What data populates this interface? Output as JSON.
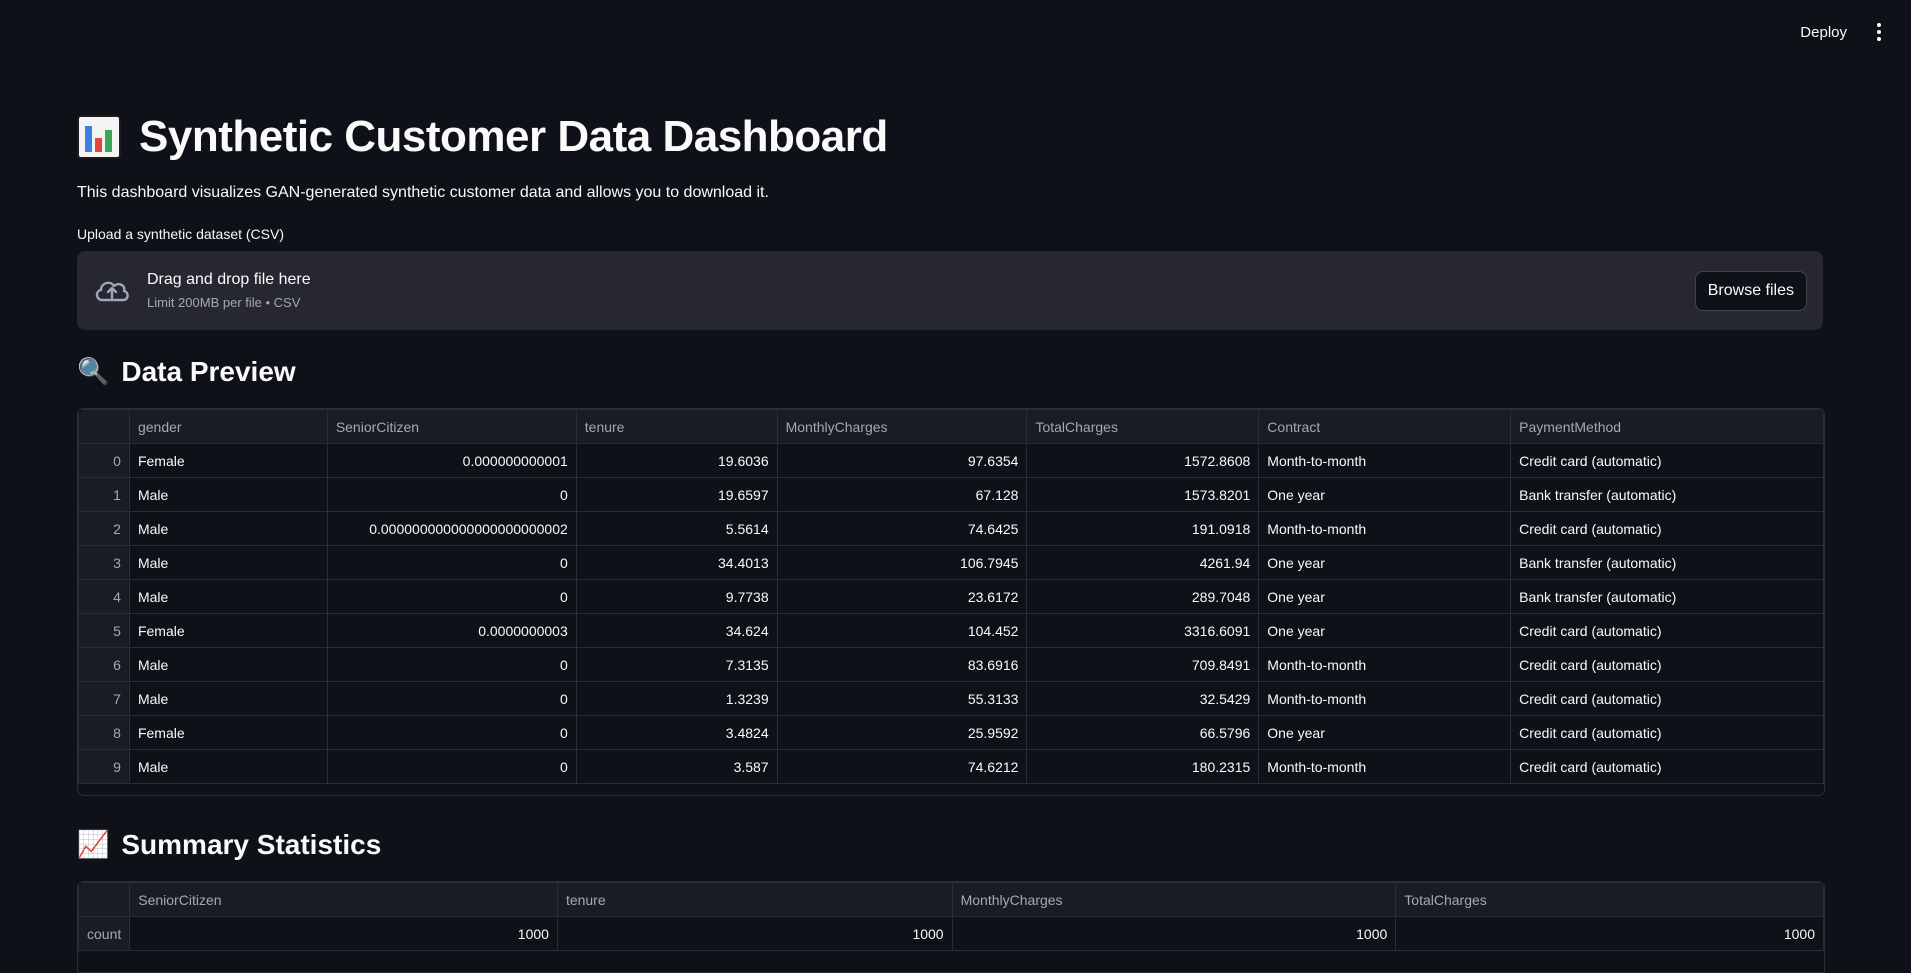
{
  "header": {
    "deploy_label": "Deploy"
  },
  "page": {
    "title_icon": "bar-chart-icon",
    "title": "Synthetic Customer Data Dashboard",
    "subtitle": "This dashboard visualizes GAN-generated synthetic customer data and allows you to download it."
  },
  "uploader": {
    "label": "Upload a synthetic dataset (CSV)",
    "drag_text": "Drag and drop file here",
    "limit_text": "Limit 200MB per file • CSV",
    "browse_label": "Browse files"
  },
  "preview": {
    "emoji": "🔍",
    "title": "Data Preview",
    "columns": [
      "gender",
      "SeniorCitizen",
      "tenure",
      "MonthlyCharges",
      "TotalCharges",
      "Contract",
      "PaymentMethod"
    ],
    "rows": [
      {
        "idx": "0",
        "cells": [
          "Female",
          "0.000000000001",
          "19.6036",
          "97.6354",
          "1572.8608",
          "Month-to-month",
          "Credit card (automatic)"
        ]
      },
      {
        "idx": "1",
        "cells": [
          "Male",
          "0",
          "19.6597",
          "67.128",
          "1573.8201",
          "One year",
          "Bank transfer (automatic)"
        ]
      },
      {
        "idx": "2",
        "cells": [
          "Male",
          "0.000000000000000000000002",
          "5.5614",
          "74.6425",
          "191.0918",
          "Month-to-month",
          "Credit card (automatic)"
        ]
      },
      {
        "idx": "3",
        "cells": [
          "Male",
          "0",
          "34.4013",
          "106.7945",
          "4261.94",
          "One year",
          "Bank transfer (automatic)"
        ]
      },
      {
        "idx": "4",
        "cells": [
          "Male",
          "0",
          "9.7738",
          "23.6172",
          "289.7048",
          "One year",
          "Bank transfer (automatic)"
        ]
      },
      {
        "idx": "5",
        "cells": [
          "Female",
          "0.0000000003",
          "34.624",
          "104.452",
          "3316.6091",
          "One year",
          "Credit card (automatic)"
        ]
      },
      {
        "idx": "6",
        "cells": [
          "Male",
          "0",
          "7.3135",
          "83.6916",
          "709.8491",
          "Month-to-month",
          "Credit card (automatic)"
        ]
      },
      {
        "idx": "7",
        "cells": [
          "Male",
          "0",
          "1.3239",
          "55.3133",
          "32.5429",
          "Month-to-month",
          "Credit card (automatic)"
        ]
      },
      {
        "idx": "8",
        "cells": [
          "Female",
          "0",
          "3.4824",
          "25.9592",
          "66.5796",
          "One year",
          "Credit card (automatic)"
        ]
      },
      {
        "idx": "9",
        "cells": [
          "Male",
          "0",
          "3.587",
          "74.6212",
          "180.2315",
          "Month-to-month",
          "Credit card (automatic)"
        ]
      }
    ]
  },
  "summary": {
    "emoji": "📈",
    "title": "Summary Statistics",
    "columns": [
      "SeniorCitizen",
      "tenure",
      "MonthlyCharges",
      "TotalCharges"
    ],
    "rows": [
      {
        "idx": "count",
        "cells": [
          "1000",
          "1000",
          "1000",
          "1000"
        ]
      }
    ]
  }
}
